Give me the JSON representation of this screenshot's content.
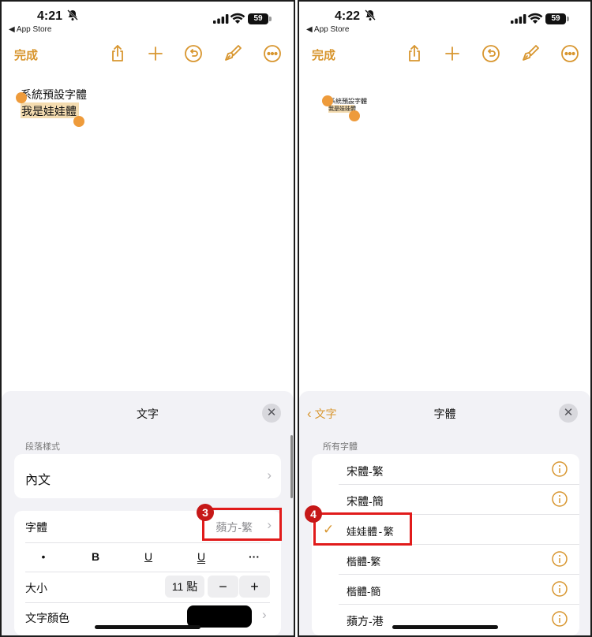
{
  "left_screen": {
    "status": {
      "time": "4:21",
      "back_app": "App Store",
      "battery": "59"
    },
    "toolbar": {
      "done_label": "完成"
    },
    "doc": {
      "line1": "系統預設字體",
      "line2": "我是娃娃體"
    },
    "sheet": {
      "title": "文字",
      "section_paragraph": "段落樣式",
      "paragraph_value": "內文",
      "font_label": "字體",
      "font_value": "蘋方-繁",
      "fmt": {
        "bullet": "•",
        "bold": "B",
        "underline": "U",
        "double_underline": "U",
        "more": "···"
      },
      "size_label": "大小",
      "size_value": "11 點",
      "minus": "−",
      "plus": "+",
      "color_label": "文字顏色",
      "color_value": "#000000"
    },
    "callout": "3"
  },
  "right_screen": {
    "status": {
      "time": "4:22",
      "back_app": "App Store",
      "battery": "59"
    },
    "toolbar": {
      "done_label": "完成"
    },
    "doc": {
      "line1": "系統預設字體",
      "line2": "我是娃娃體"
    },
    "sheet": {
      "back_label": "文字",
      "title": "字體",
      "section_all": "所有字體",
      "fonts": [
        {
          "name": "宋體-繁",
          "selected": false
        },
        {
          "name": "宋體-簡",
          "selected": false
        },
        {
          "name": "娃娃體-繁",
          "selected": true
        },
        {
          "name": "楷體-繁",
          "selected": false
        },
        {
          "name": "楷體-簡",
          "selected": false
        },
        {
          "name": "蘋方-港",
          "selected": false
        }
      ],
      "checkmark": "✓"
    },
    "callout": "4"
  },
  "colors": {
    "accent": "#d8962f",
    "handle": "#ee9b3b",
    "callout": "#e11b1b",
    "selection": "#f4dcb0"
  },
  "icons": [
    "share-icon",
    "plus-icon",
    "undo-icon",
    "paintbrush-icon",
    "more-icon",
    "bell-slash-icon",
    "signal-icon",
    "wifi-icon",
    "battery-icon",
    "info-icon",
    "close-icon",
    "chevron-right-icon",
    "chevron-left-icon",
    "checkmark-icon"
  ]
}
